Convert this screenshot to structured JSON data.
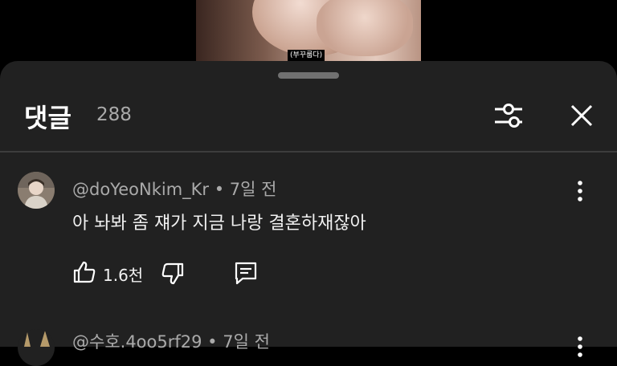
{
  "video": {
    "caption": "(부꾸룹다)"
  },
  "comments_panel": {
    "title": "댓글",
    "count": "288",
    "filter_icon": "filter-sliders-icon",
    "close_icon": "close-icon"
  },
  "comments": [
    {
      "author": "@doYeoNkim_Kr",
      "time": "• 7일 전",
      "text": "아 놔봐 좀 쟤가 지금 나랑 결혼하재잖아",
      "likes": "1.6천"
    },
    {
      "author": "@수호.4oo5rf29",
      "time": "• 7일 전"
    }
  ],
  "colors": {
    "sheet": "#212121",
    "meta": "#aaaaaa",
    "divider": "#3d3d3d"
  }
}
